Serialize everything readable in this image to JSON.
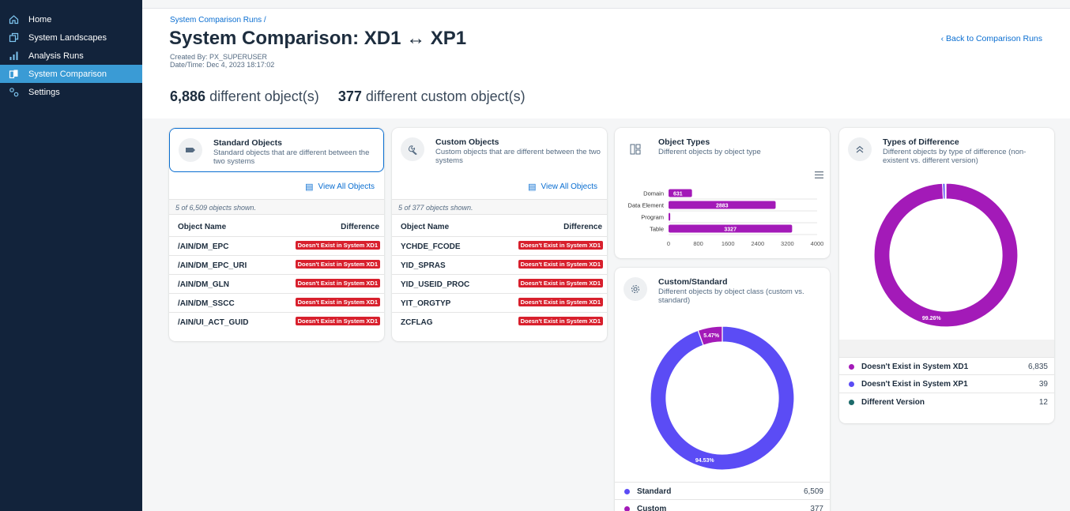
{
  "sidebar": {
    "items": [
      {
        "label": "Home",
        "icon": "home-icon"
      },
      {
        "label": "System Landscapes",
        "icon": "landscape-icon"
      },
      {
        "label": "Analysis Runs",
        "icon": "bar-chart-icon"
      },
      {
        "label": "System Comparison",
        "icon": "compare-icon",
        "active": true
      },
      {
        "label": "Settings",
        "icon": "settings-icon"
      }
    ]
  },
  "header": {
    "breadcrumb": "System Comparison Runs /",
    "title": "System Comparison: XD1 ↔ XP1",
    "created_by": "Created By: PX_SUPERUSER",
    "date_time": "Date/Time: Dec 4, 2023 18:17:02",
    "back_link": "‹  Back to Comparison Runs",
    "summary_count_1": "6,886",
    "summary_text_1": "different object(s)",
    "summary_count_2": "377",
    "summary_text_2": "different custom object(s)"
  },
  "standard_card": {
    "title": "Standard Objects",
    "subtitle": "Standard objects that are different between the two systems",
    "view_all": "View All Objects",
    "shown": "5 of 6,509 objects shown.",
    "col_name": "Object Name",
    "col_diff": "Difference",
    "rows": [
      {
        "name": "/AIN/DM_EPC",
        "diff": "Doesn't Exist in System XD1"
      },
      {
        "name": "/AIN/DM_EPC_URI",
        "diff": "Doesn't Exist in System XD1"
      },
      {
        "name": "/AIN/DM_GLN",
        "diff": "Doesn't Exist in System XD1"
      },
      {
        "name": "/AIN/DM_SSCC",
        "diff": "Doesn't Exist in System XD1"
      },
      {
        "name": "/AIN/UI_ACT_GUID",
        "diff": "Doesn't Exist in System XD1"
      }
    ]
  },
  "custom_card": {
    "title": "Custom Objects",
    "subtitle": "Custom objects that are different between the two systems",
    "view_all": "View All Objects",
    "shown": "5 of 377 objects shown.",
    "col_name": "Object Name",
    "col_diff": "Difference",
    "rows": [
      {
        "name": "YCHDE_FCODE",
        "diff": "Doesn't Exist in System XD1"
      },
      {
        "name": "YID_SPRAS",
        "diff": "Doesn't Exist in System XD1"
      },
      {
        "name": "YID_USEID_PROC",
        "diff": "Doesn't Exist in System XD1"
      },
      {
        "name": "YIT_ORGTYP",
        "diff": "Doesn't Exist in System XD1"
      },
      {
        "name": "ZCFLAG",
        "diff": "Doesn't Exist in System XD1"
      }
    ]
  },
  "object_types_card": {
    "title": "Object Types",
    "subtitle": "Different objects by object type"
  },
  "custom_standard_card": {
    "title": "Custom/Standard",
    "subtitle": "Different objects by object class (custom vs. standard)",
    "legend": [
      {
        "label": "Standard",
        "value": "6,509",
        "color": "#5b4cf5"
      },
      {
        "label": "Custom",
        "value": "377",
        "color": "#a31ab8"
      }
    ]
  },
  "types_diff_card": {
    "title": "Types of Difference",
    "subtitle": "Different objects by type of difference (non-existent vs. different version)",
    "legend": [
      {
        "label": "Doesn't Exist in System XD1",
        "value": "6,835",
        "color": "#a31ab8"
      },
      {
        "label": "Doesn't Exist in System XP1",
        "value": "39",
        "color": "#5b4cf5"
      },
      {
        "label": "Different Version",
        "value": "12",
        "color": "#1d6b6b"
      }
    ]
  },
  "chart_data": [
    {
      "type": "bar",
      "orientation": "horizontal",
      "categories": [
        "Domain",
        "Data Element",
        "Program",
        "Table"
      ],
      "values": [
        631,
        2883,
        45,
        3327
      ],
      "data_labels": [
        "631",
        "2883",
        "",
        "3327"
      ],
      "xlim": [
        0,
        4000
      ],
      "xticks": [
        "0",
        "800",
        "1600",
        "2400",
        "3200",
        "4000"
      ],
      "color": "#a31ab8"
    },
    {
      "type": "pie",
      "donut": true,
      "labels": [
        "Standard",
        "Custom"
      ],
      "values": [
        6509,
        377
      ],
      "data_labels": [
        "94.53%",
        "5.47%"
      ],
      "colors": [
        "#5b4cf5",
        "#a31ab8"
      ]
    },
    {
      "type": "pie",
      "donut": true,
      "labels": [
        "Doesn't Exist in System XD1",
        "Doesn't Exist in System XP1",
        "Different Version"
      ],
      "values": [
        6835,
        39,
        12
      ],
      "data_labels": [
        "99.26%",
        "",
        ""
      ],
      "colors": [
        "#a31ab8",
        "#5b4cf5",
        "#1d6b6b"
      ]
    }
  ]
}
